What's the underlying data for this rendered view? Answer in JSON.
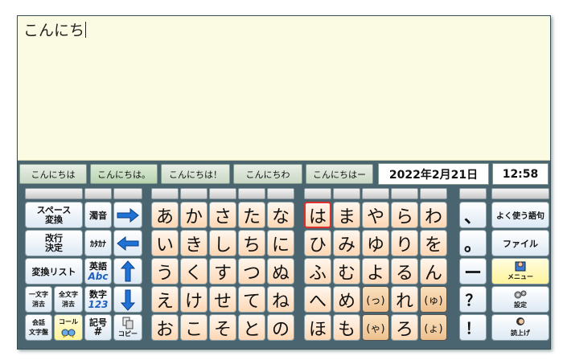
{
  "editor": {
    "text": "こんにち"
  },
  "predictions": [
    "こんにちは",
    "こんにちは。",
    "こんにちは！",
    "こんにちわ",
    "こんにちはー"
  ],
  "date": "2022年2月21日",
  "time": "12:58",
  "left_keys": {
    "space_convert": [
      "スペース",
      "変換"
    ],
    "dakuten": "濁音",
    "confirm": [
      "改行",
      "決定"
    ],
    "katakana": "ｶﾀｶﾅ",
    "convert_list": "変換リスト",
    "alphabet": [
      "英語",
      "Abc"
    ],
    "delete_one": [
      "一文字",
      "消去"
    ],
    "delete_all": [
      "全文字",
      "消去"
    ],
    "numbers": [
      "数字",
      "123"
    ],
    "conversation_board": [
      "会話",
      "文字盤"
    ],
    "call": "コール",
    "symbols": [
      "記号",
      "#"
    ],
    "copy": "コピー"
  },
  "kana_grid": [
    [
      "あ",
      "か",
      "さ",
      "た",
      "な",
      "は",
      "ま",
      "や",
      "ら",
      "わ"
    ],
    [
      "い",
      "き",
      "し",
      "ち",
      "に",
      "ひ",
      "み",
      "ゆ",
      "り",
      "を"
    ],
    [
      "う",
      "く",
      "す",
      "つ",
      "ぬ",
      "ふ",
      "む",
      "よ",
      "る",
      "ん"
    ],
    [
      "え",
      "け",
      "せ",
      "て",
      "ね",
      "へ",
      "め",
      "(っ)",
      "れ",
      "(ゅ)"
    ],
    [
      "お",
      "こ",
      "そ",
      "と",
      "の",
      "ほ",
      "も",
      "(ゃ)",
      "ろ",
      "(ょ)"
    ]
  ],
  "punct": [
    "、",
    "。",
    "ー",
    "？",
    "！"
  ],
  "right_keys": {
    "phrases": "よく使う語句",
    "file": "ファイル",
    "menu": "メニュー",
    "settings": "設定",
    "read_aloud": "読上げ"
  },
  "colors": {
    "accent_red": "#e0302c",
    "number_blue": "#1f5fbf",
    "frame": "#4a6470",
    "editor_bg": "#fbfbe3"
  },
  "icons": {
    "arrow_right": "arrow-right-icon",
    "arrow_left": "arrow-left-icon",
    "arrow_up": "arrow-up-icon",
    "arrow_down": "arrow-down-icon"
  }
}
